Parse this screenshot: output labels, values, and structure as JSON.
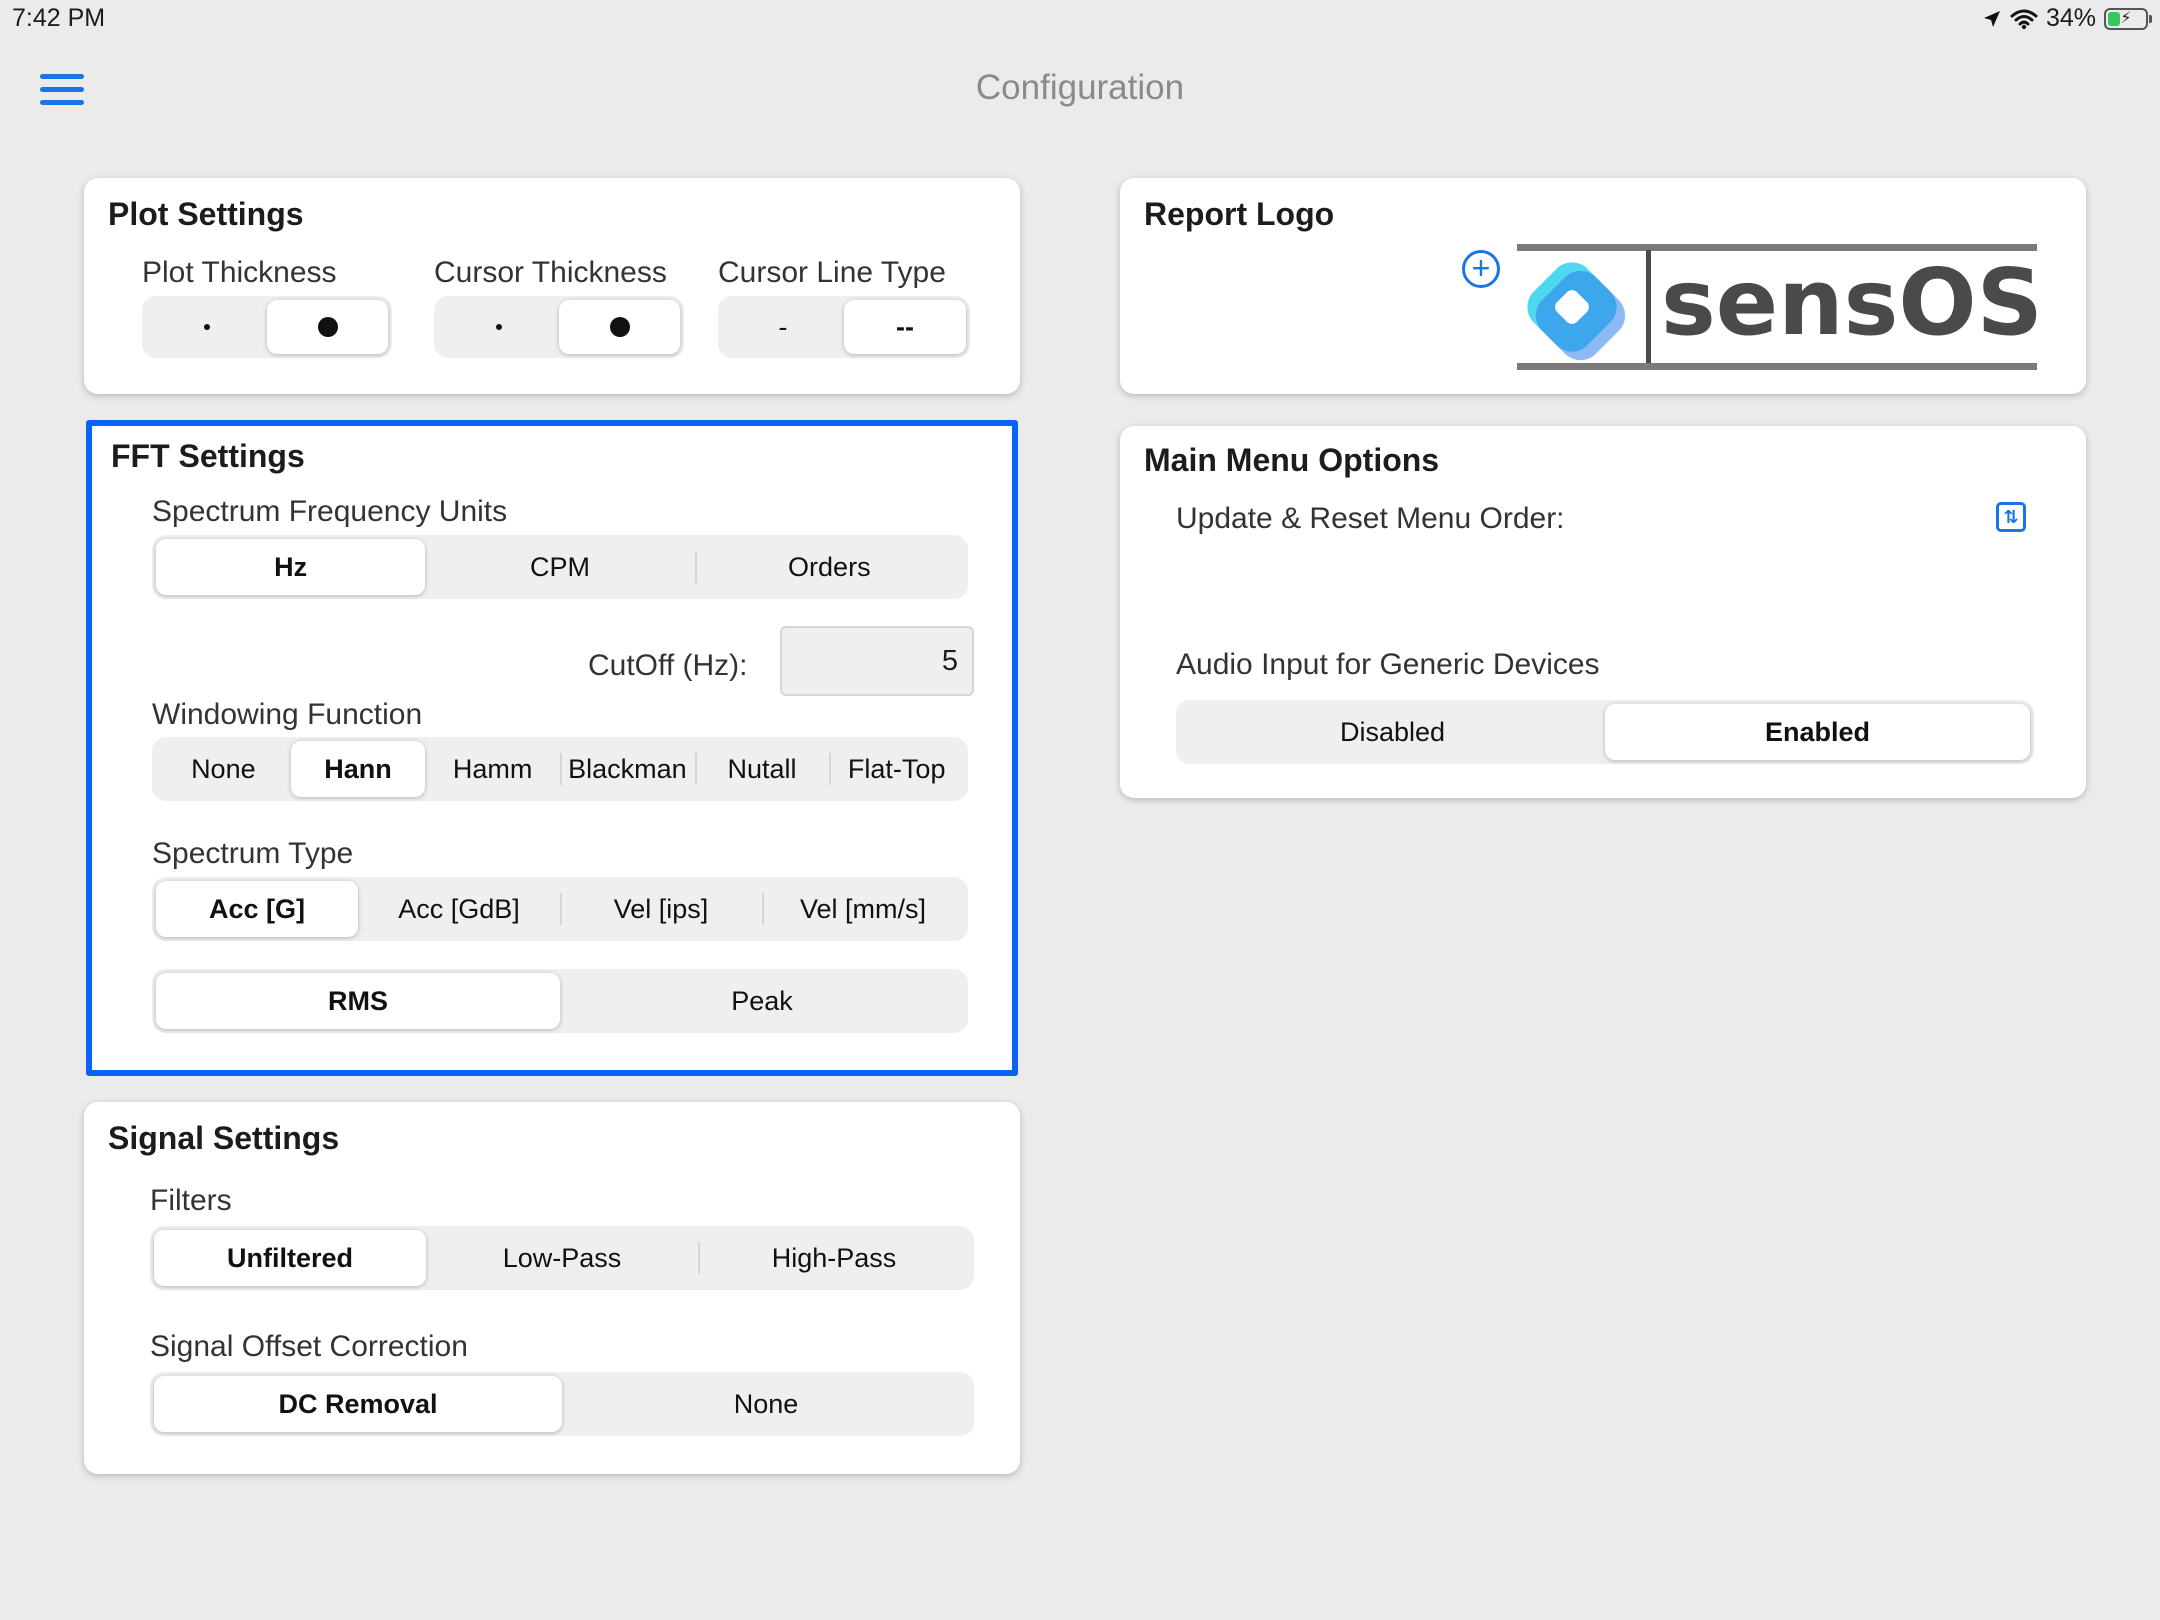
{
  "status_bar": {
    "time": "7:42 PM",
    "battery": "34%",
    "battery_level": 0.34
  },
  "nav": {
    "title": "Configuration"
  },
  "plot_settings": {
    "title": "Plot Settings",
    "plot_thickness_label": "Plot Thickness",
    "cursor_thickness_label": "Cursor Thickness",
    "cursor_line_type_label": "Cursor Line Type",
    "cursor_line_type_options": [
      "-",
      "--"
    ],
    "selected": {
      "plot_thickness": "thick",
      "cursor_thickness": "thick",
      "cursor_line_type": "--"
    }
  },
  "fft_settings": {
    "title": "FFT Settings",
    "freq_units_label": "Spectrum Frequency Units",
    "freq_units": [
      "Hz",
      "CPM",
      "Orders"
    ],
    "cutoff_label": "CutOff (Hz):",
    "cutoff_value": "5",
    "windowing_label": "Windowing Function",
    "windowing": [
      "None",
      "Hann",
      "Hamm",
      "Blackman",
      "Nutall",
      "Flat-Top"
    ],
    "spectrum_type_label": "Spectrum Type",
    "spectrum_type": [
      "Acc [G]",
      "Acc [GdB]",
      "Vel [ips]",
      "Vel [mm/s]"
    ],
    "amplitude": [
      "RMS",
      "Peak"
    ]
  },
  "signal_settings": {
    "title": "Signal Settings",
    "filters_label": "Filters",
    "filters": [
      "Unfiltered",
      "Low-Pass",
      "High-Pass"
    ],
    "offset_label": "Signal Offset Correction",
    "offset": [
      "DC Removal",
      "None"
    ]
  },
  "report_logo": {
    "title": "Report Logo",
    "logo_text": "sensOS",
    "brand_colors": {
      "logo_cyan": "#4fd7f0",
      "logo_blue": "#2f80ed",
      "logo_text": "#4a4a4a"
    }
  },
  "main_menu": {
    "title": "Main Menu Options",
    "reset_label": "Update & Reset Menu Order:",
    "audio_label": "Audio Input for Generic Devices",
    "audio_options": [
      "Disabled",
      "Enabled"
    ]
  },
  "colors": {
    "accent": "#1a73e8",
    "selection_border": "#0a63f6",
    "background": "#ebebeb"
  }
}
